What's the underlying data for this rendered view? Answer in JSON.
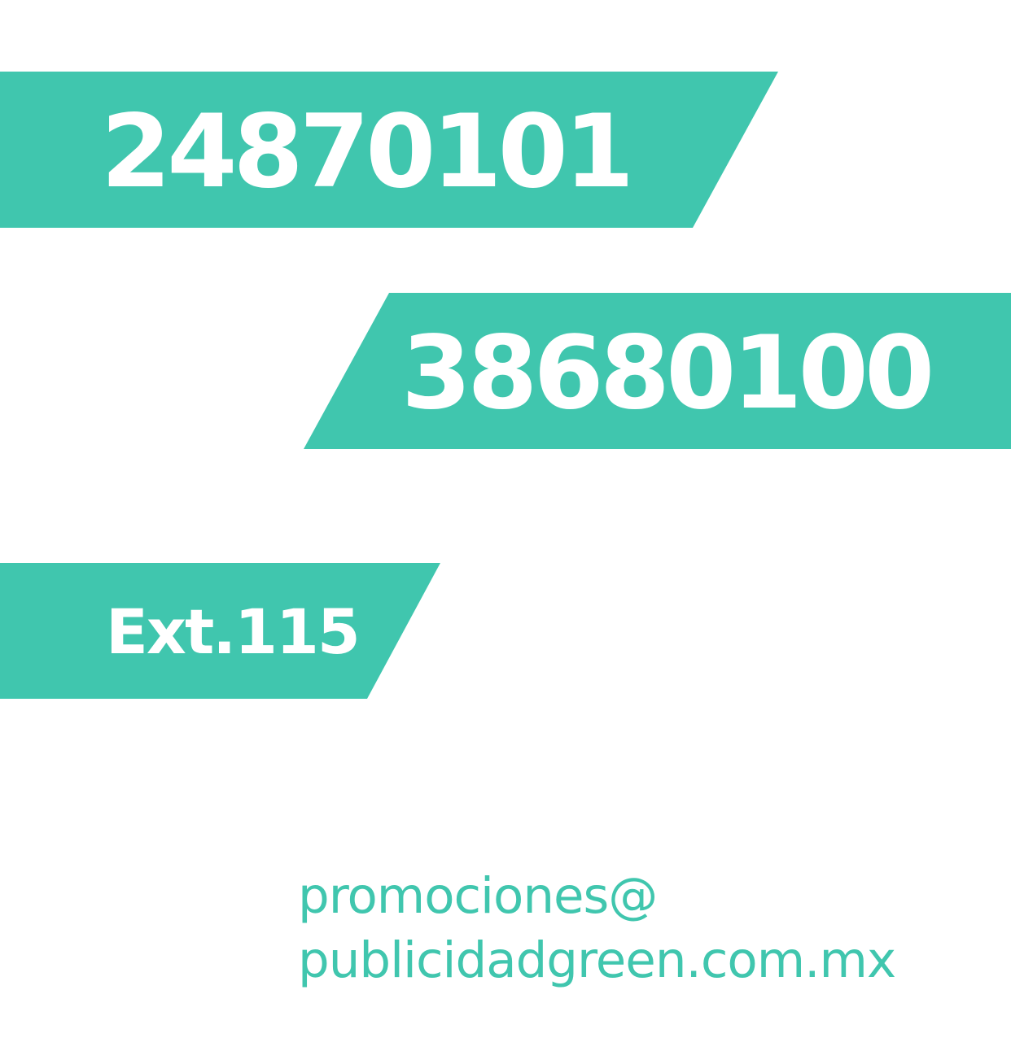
{
  "colors": {
    "accent": "#40C6AE",
    "banner_text": "#FFFFFF",
    "background": "#FFFFFF"
  },
  "phones": {
    "primary": "24870101",
    "secondary": "38680100",
    "extension": "Ext.115"
  },
  "email": {
    "line1": "promociones@",
    "line2": "publicidadgreen.com.mx"
  }
}
